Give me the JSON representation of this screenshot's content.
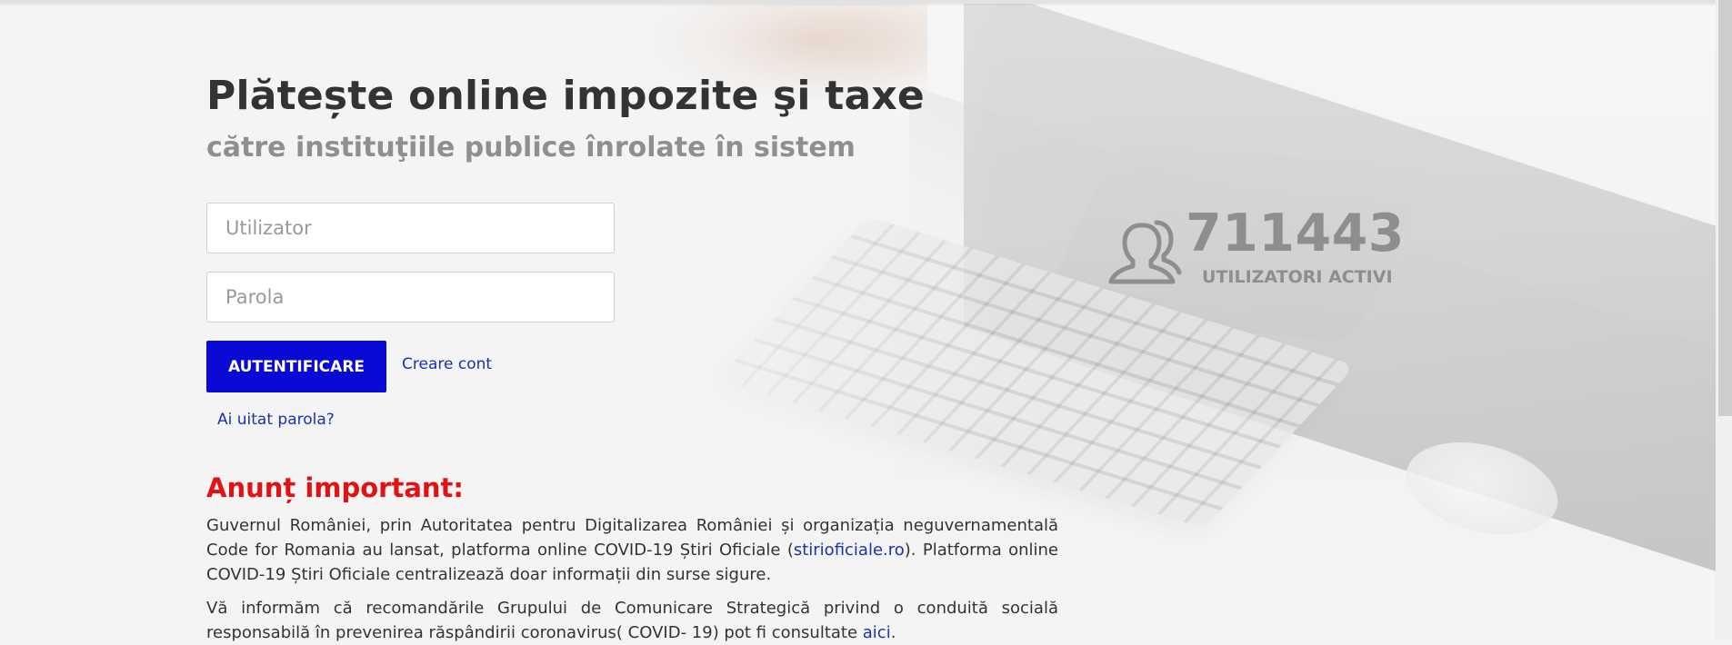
{
  "hero": {
    "title": "Plătește online impozite şi taxe",
    "subtitle": "către instituţiile publice înrolate în sistem"
  },
  "login": {
    "username_placeholder": "Utilizator",
    "password_placeholder": "Parola",
    "username_value": "",
    "password_value": "",
    "submit_label": "AUTENTIFICARE",
    "create_account_label": "Creare cont",
    "forgot_password_label": "Ai uitat parola?"
  },
  "stats": {
    "icon": "users-icon",
    "count": "711443",
    "label": "UTILIZATORI ACTIVI"
  },
  "notice": {
    "title": "Anunț important:",
    "p1_before": "Guvernul României, prin Autoritatea pentru Digitalizarea României și organizația neguvernamentală Code for Romania au lansat, platforma online COVID-19 Știri Oficiale (",
    "p1_link": "stirioficiale.ro",
    "p1_after": "). Platforma online COVID-19 Știri Oficiale centralizează doar informații din surse sigure.",
    "p2_before": "Vă informăm că recomandările Grupului de Comunicare Strategică privind o conduită socială responsabilă în prevenirea răspândirii coronavirus( COVID- 19) pot fi consultate ",
    "p2_link": "aici",
    "p2_after": "."
  },
  "colors": {
    "primary_button": "#0a0ad7",
    "link": "#1c31b2",
    "notice_title": "#e31212",
    "stats": "#8e8e8e"
  }
}
